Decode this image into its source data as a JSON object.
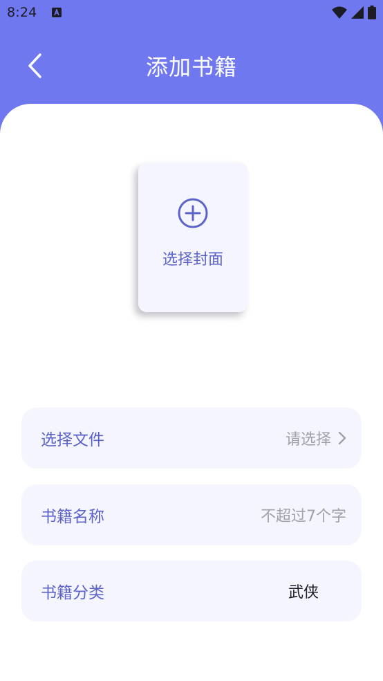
{
  "status_bar": {
    "time": "8:24"
  },
  "header": {
    "title": "添加书籍"
  },
  "cover": {
    "label": "选择封面"
  },
  "form": {
    "file": {
      "label": "选择文件",
      "value": "请选择"
    },
    "name": {
      "label": "书籍名称",
      "placeholder": "不超过7个字"
    },
    "category": {
      "label": "书籍分类",
      "value": "武侠"
    }
  },
  "colors": {
    "accent": "#6f78ee",
    "label": "#5c63c8",
    "field_bg": "#f4f5fe"
  },
  "icons": [
    "notification-a-icon",
    "wifi-icon",
    "signal-icon",
    "battery-icon",
    "back-arrow-icon",
    "add-circle-icon",
    "chevron-right-icon"
  ]
}
